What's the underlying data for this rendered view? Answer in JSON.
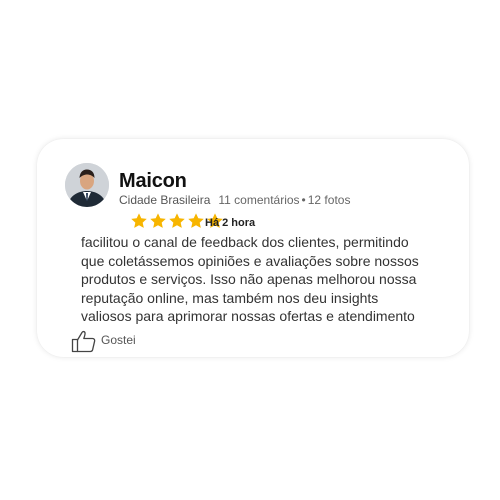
{
  "review": {
    "author_name": "Maicon",
    "location": "Cidade Brasileira",
    "comment_count": "11 comentários",
    "separator": "•",
    "photo_count": "12 fotos",
    "rating": 5,
    "rating_max": 5,
    "time_ago": "Há 2 hora",
    "text": "facilitou o canal de feedback dos clientes, permitindo que coletássemos opiniões e avaliações sobre nossos produtos e serviços. Isso não apenas melhorou nossa reputação online, mas também nos deu insights valiosos para aprimorar nossas ofertas e atendimento",
    "like_label": "Gostei"
  },
  "icons": {
    "star": "star-icon",
    "like": "thumbs-up-icon",
    "avatar": "user-avatar"
  },
  "colors": {
    "star": "#f7b500",
    "name": "#111111",
    "text": "#333333",
    "meta": "#555555"
  }
}
